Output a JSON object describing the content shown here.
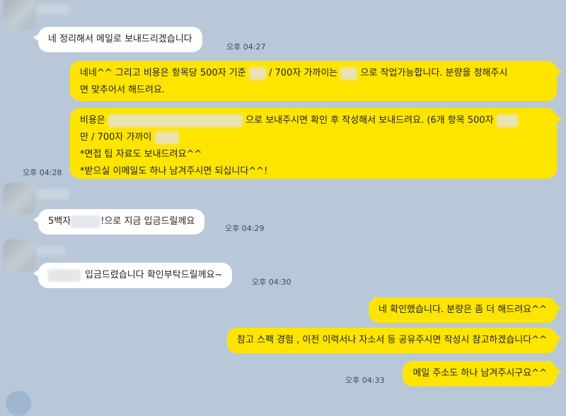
{
  "colors": {
    "background": "#b9c8d8",
    "incoming_bubble": "#ffffff",
    "outgoing_bubble": "#fee500"
  },
  "messages": {
    "m1": {
      "text": "네 정리해서 메일로 보내드리겠습니다",
      "time": "오후 04:27"
    },
    "m2": {
      "part1": "네네^^ 그리고 비용은 항목당 500자 기준",
      "part2": "/ 700자 가까이는",
      "part3": "으로 작업가능합니다. 분량을 정해주시",
      "line2": "면 맞추어서 해드려요."
    },
    "m3": {
      "part1": "비용은",
      "part2": "으로 보내주시면 확인 후 작성해서 보내드려요. (6개 항목 500자",
      "line2_start": "만 / 700자 가까이",
      "line3": "*면접 팁 자료도 보내드려요^^",
      "line4": "*받으실 이메일도 하나 남겨주시면 되십니다^^!",
      "time": "오후 04:28"
    },
    "m4": {
      "part1": "5백자",
      "part2": "!으로 지금 입금드릴께요",
      "time": "오후 04:29"
    },
    "m5": {
      "text": "입금드렸습니다 확인부탁드릴께요~",
      "time": "오후 04:30"
    },
    "m6": {
      "text": "네 확인했습니다. 분량은 좀 더 해드려요^^"
    },
    "m7": {
      "text": "참고 스펙 경험 , 이전 이력서나 자소서 등 공유주시면 작성시 참고하겠습니다^^"
    },
    "m8": {
      "text": "메일 주소도 하나 남겨주시구요^^",
      "time": "오후 04:33"
    }
  }
}
